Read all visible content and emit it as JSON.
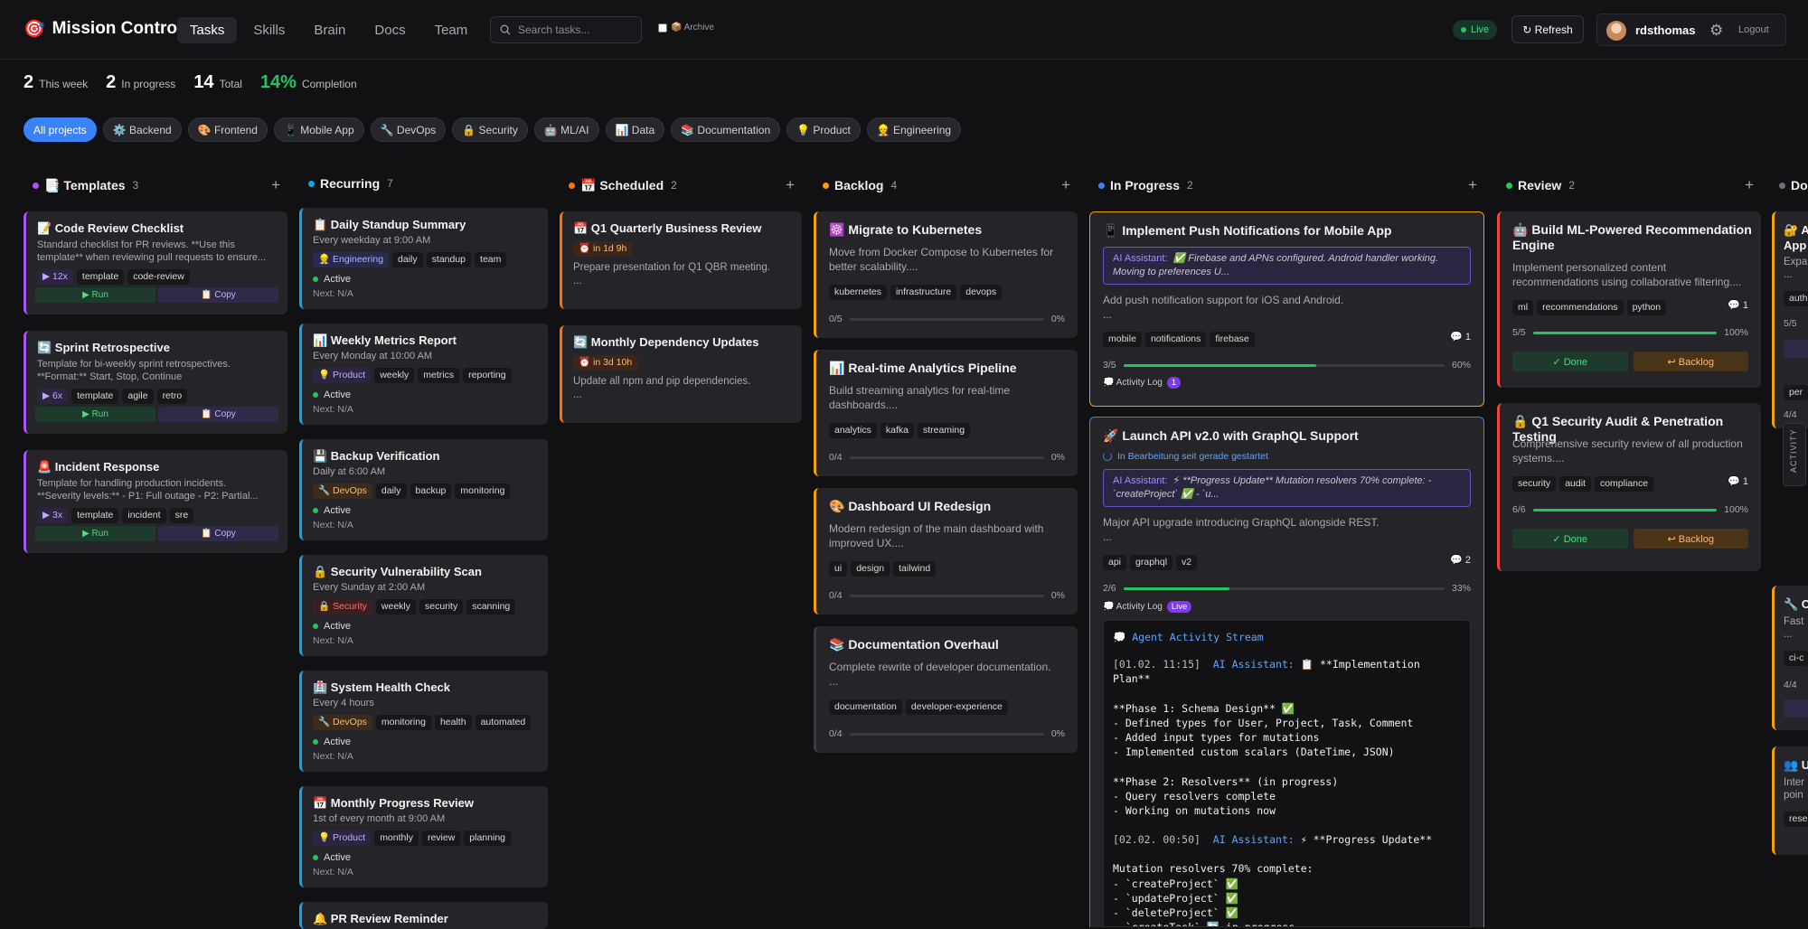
{
  "app": {
    "logo_icon": "🎯",
    "title": "Mission Control"
  },
  "nav": [
    "Tasks",
    "Skills",
    "Brain",
    "Docs",
    "Team"
  ],
  "search": {
    "placeholder": "Search tasks..."
  },
  "archive_label": "📦 Archive",
  "live_label": "Live",
  "refresh_label": "↻ Refresh",
  "user": {
    "name": "rdsthomas",
    "logout": "Logout"
  },
  "stats": [
    {
      "num": "2",
      "label": "This week"
    },
    {
      "num": "2",
      "label": "In progress"
    },
    {
      "num": "14",
      "label": "Total"
    },
    {
      "num": "14%",
      "label": "Completion"
    }
  ],
  "filters": [
    "All projects",
    "⚙️ Backend",
    "🎨 Frontend",
    "📱 Mobile App",
    "🔧 DevOps",
    "🔒 Security",
    "🤖 ML/AI",
    "📊 Data",
    "📚 Documentation",
    "💡 Product",
    "👷 Engineering"
  ],
  "colors": {
    "templates": "#a855f7",
    "recurring": "#0ea5e9",
    "scheduled": "#f97316",
    "backlog": "#f59e0b",
    "in_progress": "#3b82f6",
    "review": "#22c55e",
    "done": "#6b7280"
  },
  "columns": {
    "templates": {
      "title": "📑 Templates",
      "count": "3"
    },
    "recurring": {
      "title": "Recurring",
      "count": "7"
    },
    "scheduled": {
      "title": "📅 Scheduled",
      "count": "2"
    },
    "backlog": {
      "title": "Backlog",
      "count": "4"
    },
    "in_progress": {
      "title": "In Progress",
      "count": "2"
    },
    "review": {
      "title": "Review",
      "count": "2"
    },
    "done": {
      "title": "Do"
    }
  },
  "templates": [
    {
      "title": "📝 Code Review Checklist",
      "desc1": "Standard checklist for PR reviews. **Use this",
      "desc2": "template** when reviewing pull requests to ensure...",
      "runs": "▶ 12x",
      "tags": [
        "template",
        "code-review"
      ],
      "run": "▶ Run",
      "copy": "📋 Copy"
    },
    {
      "title": "🔄 Sprint Retrospective",
      "desc1": "Template for bi-weekly sprint retrospectives.",
      "desc2": "**Format:** Start, Stop, Continue",
      "runs": "▶ 6x",
      "tags": [
        "template",
        "agile",
        "retro"
      ],
      "run": "▶ Run",
      "copy": "📋 Copy"
    },
    {
      "title": "🚨 Incident Response",
      "desc1": "Template for handling production incidents.",
      "desc2": "**Severity levels:** - P1: Full outage - P2: Partial...",
      "runs": "▶ 3x",
      "tags": [
        "template",
        "incident",
        "sre"
      ],
      "run": "▶ Run",
      "copy": "📋 Copy"
    }
  ],
  "recurring": [
    {
      "title": "📋 Daily Standup Summary",
      "schedule": "Every weekday at 9:00 AM",
      "project": "👷 Engineering",
      "tags": [
        "daily",
        "standup",
        "team"
      ],
      "status": "Active",
      "next": "Next: N/A"
    },
    {
      "title": "📊 Weekly Metrics Report",
      "schedule": "Every Monday at 10:00 AM",
      "project": "💡 Product",
      "tags": [
        "weekly",
        "metrics",
        "reporting"
      ],
      "status": "Active",
      "next": "Next: N/A"
    },
    {
      "title": "💾 Backup Verification",
      "schedule": "Daily at 6:00 AM",
      "project": "🔧 DevOps",
      "tags": [
        "daily",
        "backup",
        "monitoring"
      ],
      "status": "Active",
      "next": "Next: N/A"
    },
    {
      "title": "🔒 Security Vulnerability Scan",
      "schedule": "Every Sunday at 2:00 AM",
      "project": "🔒 Security",
      "tags": [
        "weekly",
        "security",
        "scanning"
      ],
      "status": "Active",
      "next": "Next: N/A"
    },
    {
      "title": "🏥 System Health Check",
      "schedule": "Every 4 hours",
      "project": "🔧 DevOps",
      "tags": [
        "monitoring",
        "health",
        "automated"
      ],
      "status": "Active",
      "next": "Next: N/A"
    },
    {
      "title": "📅 Monthly Progress Review",
      "schedule": "1st of every month at 9:00 AM",
      "project": "💡 Product",
      "tags": [
        "monthly",
        "review",
        "planning"
      ],
      "status": "Active",
      "next": "Next: N/A"
    },
    {
      "title": "🔔 PR Review Reminder"
    }
  ],
  "scheduled": [
    {
      "title": "📅 Q1 Quarterly Business Review",
      "timer": "⏰ in 1d 9h",
      "desc1": "Prepare presentation for Q1 QBR meeting.",
      "desc2": "..."
    },
    {
      "title": "🔄 Monthly Dependency Updates",
      "timer": "⏰ in 3d 10h",
      "desc1": "Update all npm and pip dependencies.",
      "desc2": "..."
    }
  ],
  "backlog": [
    {
      "title": "☸️ Migrate to Kubernetes",
      "desc1": "Move from Docker Compose to Kubernetes for",
      "desc2": "better scalability....",
      "tags": [
        "kubernetes",
        "infrastructure",
        "devops"
      ],
      "prog": "0/5",
      "pct": "0%",
      "fill": 0
    },
    {
      "title": "📊 Real-time Analytics Pipeline",
      "desc1": "Build streaming analytics for real-time",
      "desc2": "dashboards....",
      "tags": [
        "analytics",
        "kafka",
        "streaming"
      ],
      "prog": "0/4",
      "pct": "0%",
      "fill": 0
    },
    {
      "title": "🎨 Dashboard UI Redesign",
      "desc1": "Modern redesign of the main dashboard with",
      "desc2": "improved UX....",
      "tags": [
        "ui",
        "design",
        "tailwind"
      ],
      "prog": "0/4",
      "pct": "0%",
      "fill": 0
    },
    {
      "title": "📚 Documentation Overhaul",
      "desc1": "Complete rewrite of developer documentation.",
      "desc2": "...",
      "tags": [
        "documentation",
        "developer-experience"
      ],
      "prog": "0/4",
      "pct": "0%",
      "fill": 0
    }
  ],
  "in_progress": [
    {
      "title": "📱 Implement Push Notifications for Mobile App",
      "ai_label": "AI Assistant:",
      "ai1": "✅ Firebase and APNs configured. Android handler working.",
      "ai2": "Moving to preferences U...",
      "desc1": "Add push notification support for iOS and Android.",
      "desc2": "...",
      "tags": [
        "mobile",
        "notifications",
        "firebase"
      ],
      "comments": "💬 1",
      "prog": "3/5",
      "pct": "60%",
      "fill": 0.6,
      "log": "💭 Activity Log",
      "log_badge": "1"
    },
    {
      "title": "🚀 Launch API v2.0 with GraphQL Support",
      "working": "In Bearbeitung seit gerade gestartet",
      "ai_label": "AI Assistant:",
      "ai1": "⚡ **Progress Update** Mutation resolvers 70% complete: -",
      "ai2": "`createProject` ✅ - `u...",
      "desc1": "Major API upgrade introducing GraphQL alongside REST.",
      "desc2": "...",
      "tags": [
        "api",
        "graphql",
        "v2"
      ],
      "comments": "💬 2",
      "prog": "2/6",
      "pct": "33%",
      "fill": 0.33,
      "log": "💭 Activity Log",
      "log_badge": "Live"
    }
  ],
  "stream": {
    "title": "💭 Agent Activity Stream",
    "ts1": "[01.02. 11:15]",
    "who": "AI Assistant:",
    "msg1": "📋 **Implementation Plan**",
    "block1": "**Phase 1: Schema Design** ✅\n- Defined types for User, Project, Task, Comment\n- Added input types for mutations\n- Implemented custom scalars (DateTime, JSON)\n\n**Phase 2: Resolvers** (in progress)\n- Query resolvers complete\n- Working on mutations now",
    "ts2": "[02.02. 00:50]",
    "msg2": "⚡ **Progress Update**",
    "block2": "Mutation resolvers 70% complete:\n- `createProject` ✅\n- `updateProject` ✅\n- `deleteProject` ✅\n- `createTask` 🔄 in progress"
  },
  "review": [
    {
      "title1": "🤖 Build ML-Powered Recommendation",
      "title2": "Engine",
      "desc1": "Implement personalized content",
      "desc2": "recommendations using collaborative filtering....",
      "tags": [
        "ml",
        "recommendations",
        "python"
      ],
      "comments": "💬 1",
      "prog": "5/5",
      "pct": "100%",
      "fill": 1,
      "done": "✓ Done",
      "back": "↩ Backlog"
    },
    {
      "title1": "🔒 Q1 Security Audit & Penetration Testing",
      "desc1": "Comprehensive security review of all production",
      "desc2": "systems....",
      "tags": [
        "security",
        "audit",
        "compliance"
      ],
      "comments": "💬 1",
      "prog": "6/6",
      "pct": "100%",
      "fill": 1,
      "done": "✓ Done",
      "back": "↩ Backlog"
    }
  ],
  "done_partial": {
    "t1": "🔐 A",
    "t2": "App",
    "d1": "Expa",
    "d2": "...",
    "tag": "auth",
    "prog": "5/5",
    "t3": "🔧 C",
    "d3": "Fast",
    "d4": "...",
    "tag2": "ci-c",
    "prog2": "4/4",
    "t4": "👥 U",
    "d5": "Inter",
    "d6": "poin",
    "tag3": "rese",
    "p1": "per",
    "p2": "4/4",
    "activity": "ACTIVITY"
  }
}
